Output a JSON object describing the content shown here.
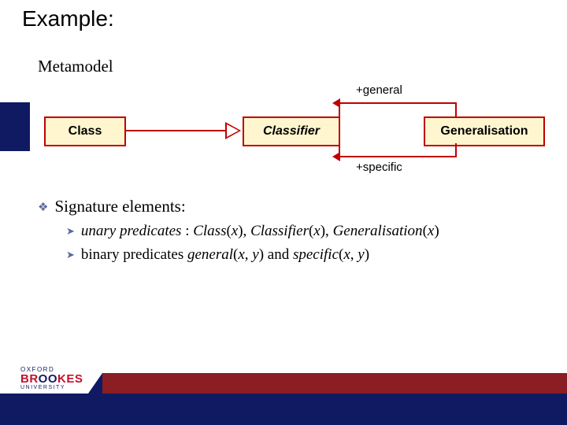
{
  "title": "Example:",
  "metamodel_label": "Metamodel",
  "diagram": {
    "class_box": "Class",
    "classifier_box": "Classifier",
    "generalisation_box": "Generalisation",
    "role_general": "+general",
    "role_specific": "+specific"
  },
  "bullets": {
    "heading": "Signature elements:",
    "sub1_lead": "unary predicates",
    "sub1_rest": " : ",
    "sub1_p1": "Class",
    "sub1_p2": "Classifier",
    "sub1_p3": "Generalisation",
    "arg_x": "x",
    "sub2_lead": "binary predicates ",
    "sub2_p1": "general",
    "sub2_mid": " and ",
    "sub2_p2": "specific",
    "arg_xy_open": "(",
    "arg_xy_sep": ", ",
    "arg_xy_close": ")",
    "arg_y": "y"
  },
  "logo": {
    "line1": "OXFORD",
    "line2a": "BR",
    "line2b": "OO",
    "line2c": "KES",
    "line3": "UNIVERSITY"
  }
}
